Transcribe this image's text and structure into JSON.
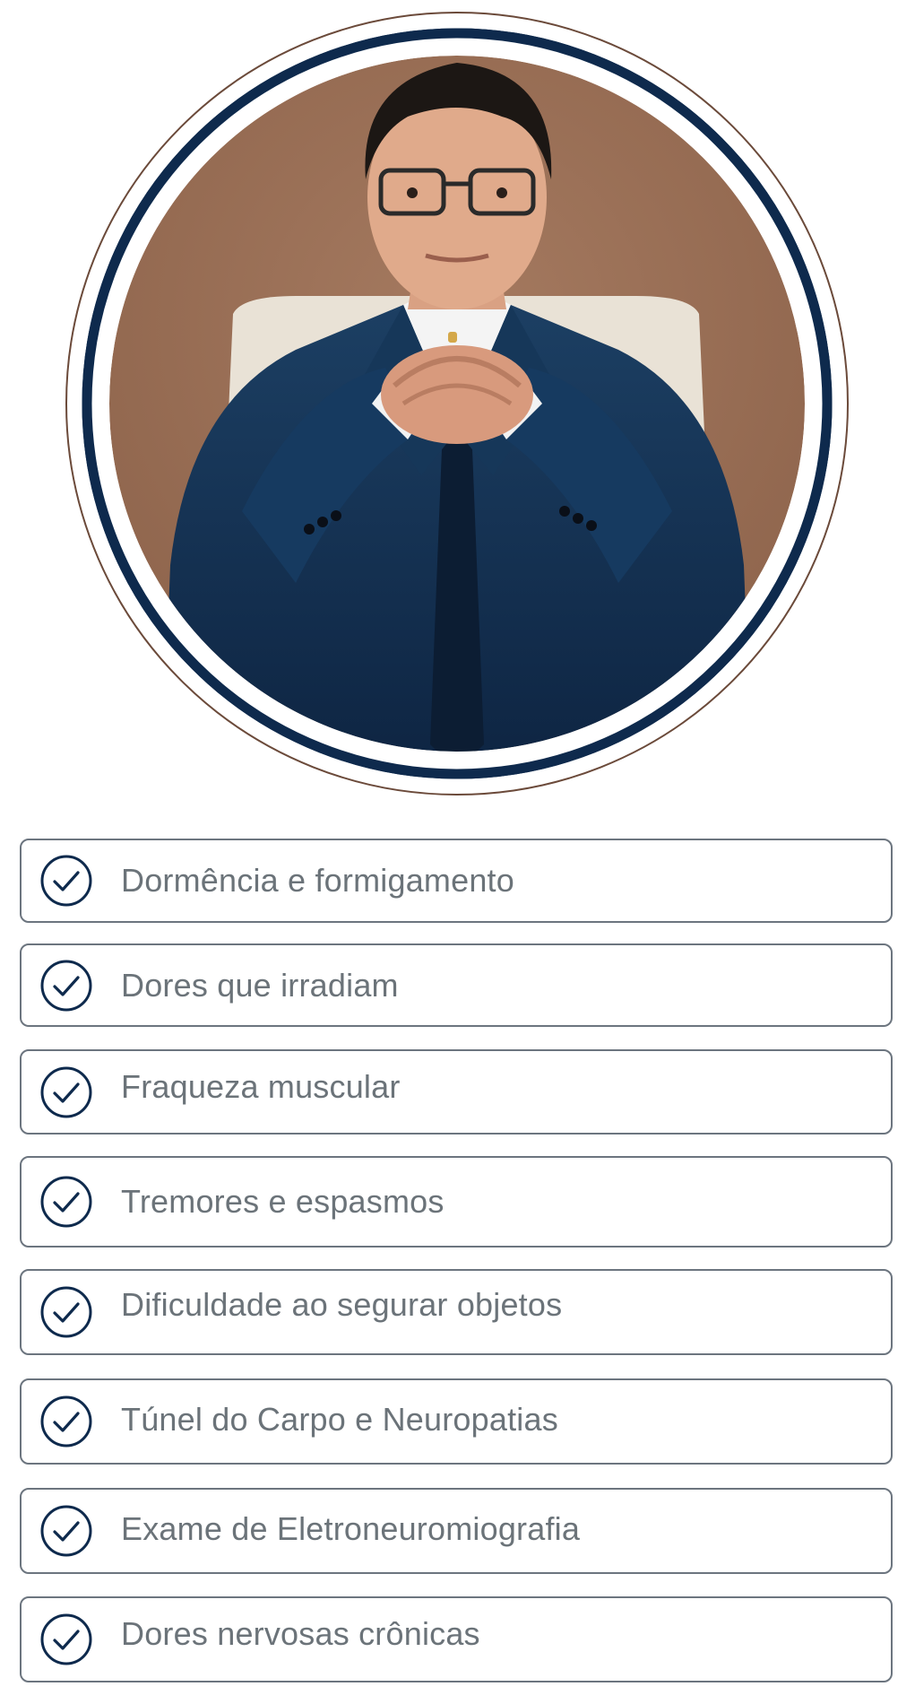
{
  "colors": {
    "navy": "#0e2a4d",
    "outline_brown": "#6b4a3a",
    "backdrop": "#9a7058",
    "text_gray": "#6b7379",
    "border_gray": "#6c757f"
  },
  "portrait": {
    "image": "doctor-portrait-photo",
    "frame": "circular-frame"
  },
  "symptoms": {
    "icon": "check-circle-icon",
    "items": [
      {
        "label": "Dormência e formigamento"
      },
      {
        "label": "Dores que irradiam"
      },
      {
        "label": "Fraqueza muscular"
      },
      {
        "label": "Tremores e espasmos"
      },
      {
        "label": "Dificuldade ao segurar objetos"
      },
      {
        "label": "Túnel do Carpo e Neuropatias"
      },
      {
        "label": "Exame de Eletroneuromiografia"
      },
      {
        "label": "Dores nervosas crônicas"
      }
    ]
  }
}
